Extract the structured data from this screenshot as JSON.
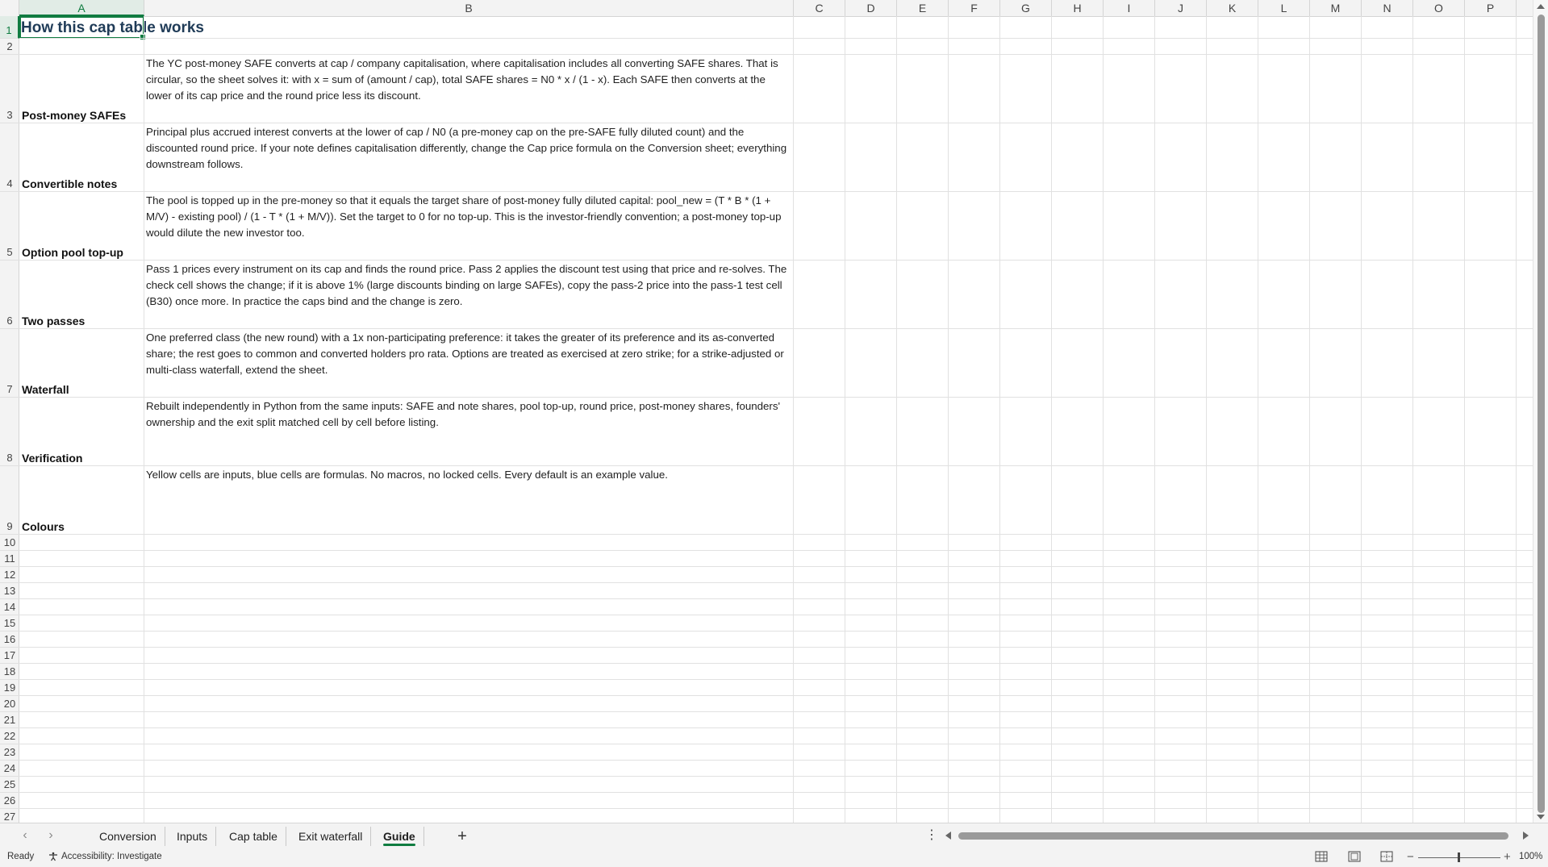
{
  "sheet": {
    "columns": [
      "A",
      "B",
      "C",
      "D",
      "E",
      "F",
      "G",
      "H",
      "I",
      "J",
      "K",
      "L",
      "M",
      "N",
      "O",
      "P"
    ],
    "selected_column": "A",
    "row_numbers": [
      "1",
      "2",
      "3",
      "4",
      "5",
      "6",
      "7",
      "8",
      "9",
      "10",
      "11",
      "12",
      "13",
      "14",
      "15",
      "16",
      "17",
      "18",
      "19",
      "20",
      "21",
      "22",
      "23",
      "24",
      "25",
      "26",
      "27"
    ],
    "title": "How this cap table works",
    "sections": [
      {
        "label": "Post-money SAFEs",
        "text": "The YC post-money SAFE converts at cap / company capitalisation, where capitalisation includes all converting SAFE shares. That is circular, so the sheet solves it: with x = sum of (amount / cap), total SAFE shares = N0 * x / (1 - x). Each SAFE then converts at the lower of its cap price and the round price less its discount."
      },
      {
        "label": "Convertible notes",
        "text": "Principal plus accrued interest converts at the lower of cap / N0 (a pre-money cap on the pre-SAFE fully diluted count) and the discounted round price. If your note defines capitalisation differently, change the Cap price formula on the Conversion sheet; everything downstream follows."
      },
      {
        "label": "Option pool top-up",
        "text": "The pool is topped up in the pre-money so that it equals the target share of post-money fully diluted capital: pool_new = (T * B * (1 + M/V) - existing pool) / (1 - T * (1 + M/V)). Set the target to 0 for no top-up. This is the investor-friendly convention; a post-money top-up would dilute the new investor too."
      },
      {
        "label": "Two passes",
        "text": "Pass 1 prices every instrument on its cap and finds the round price. Pass 2 applies the discount test using that price and re-solves. The check cell shows the change; if it is above 1% (large discounts binding on large SAFEs), copy the pass-2 price into the pass-1 test cell (B30) once more. In practice the caps bind and the change is zero."
      },
      {
        "label": "Waterfall",
        "text": "One preferred class (the new round) with a 1x non-participating preference: it takes the greater of its preference and its as-converted share; the rest goes to common and converted holders pro rata. Options are treated as exercised at zero strike; for a strike-adjusted or multi-class waterfall, extend the sheet."
      },
      {
        "label": "Verification",
        "text": "Rebuilt independently in Python from the same inputs: SAFE and note shares, pool top-up, round price, post-money shares, founders' ownership and the exit split matched cell by cell before listing."
      },
      {
        "label": "Colours",
        "text": "Yellow cells are inputs, blue cells are formulas. No macros, no locked cells. Every default is an example value."
      }
    ]
  },
  "tabs": [
    {
      "label": "Conversion",
      "active": false
    },
    {
      "label": "Inputs",
      "active": false
    },
    {
      "label": "Cap table",
      "active": false
    },
    {
      "label": "Exit waterfall",
      "active": false
    },
    {
      "label": "Guide",
      "active": true
    }
  ],
  "status": {
    "ready": "Ready",
    "accessibility": "Accessibility: Investigate",
    "zoom": "100%",
    "zoom_fraction": 0.48
  },
  "colors": {
    "accent": "#107c41",
    "title": "#1f3b57",
    "grid": "#e1e1e1"
  }
}
